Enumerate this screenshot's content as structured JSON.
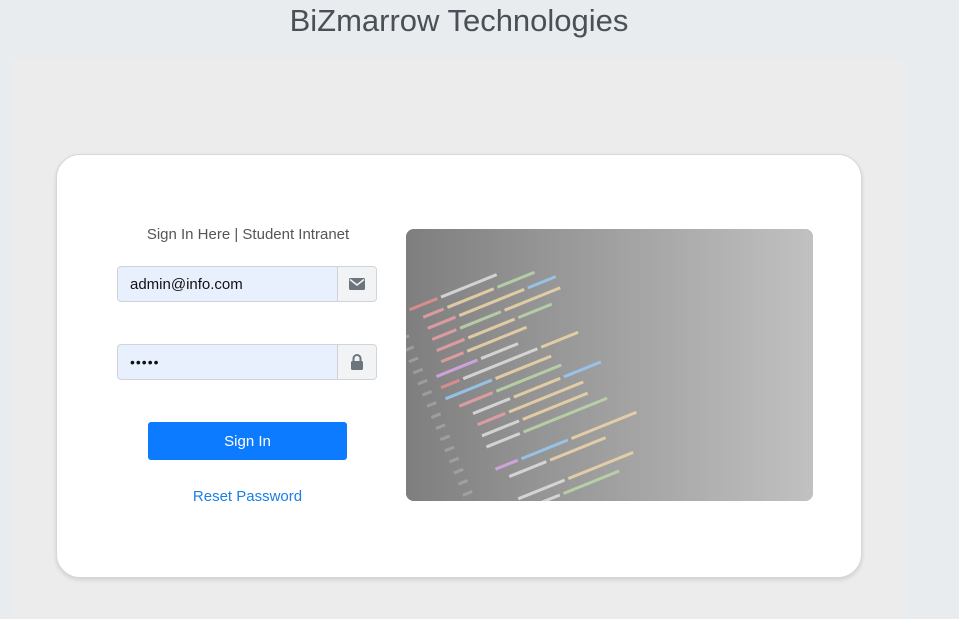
{
  "header": {
    "title": "BiZmarrow Technologies"
  },
  "login": {
    "heading": "Sign In Here | Student Intranet",
    "email_value": "admin@info.com",
    "password_value": "•••••",
    "email_icon": "envelope-icon",
    "password_icon": "lock-icon",
    "submit_label": "Sign In",
    "reset_label": "Reset Password"
  },
  "hero": {
    "image": "code-editor-screenshot"
  },
  "colors": {
    "primary": "#0d7bff",
    "link": "#1a7fe6",
    "autofill_bg": "#e8f0fe",
    "page_bg": "#e9ecef"
  }
}
